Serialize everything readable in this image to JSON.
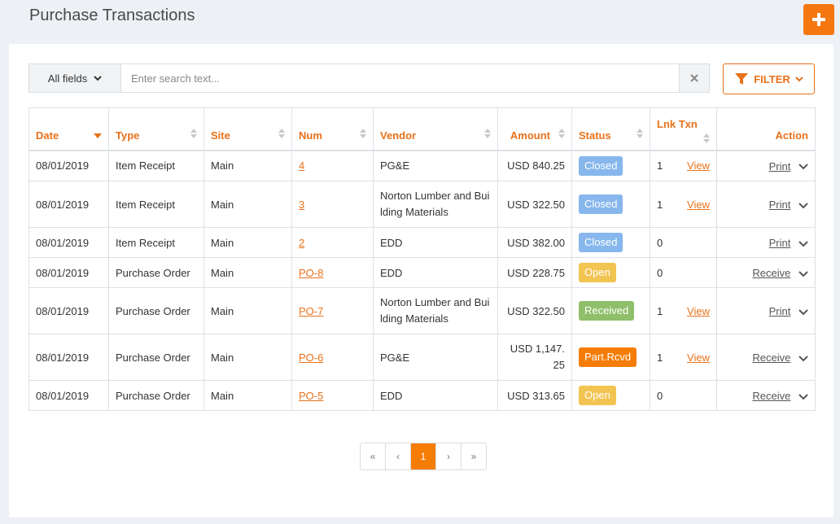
{
  "header": {
    "title": "Purchase Transactions"
  },
  "search": {
    "field": "All fields",
    "placeholder": "Enter search text..."
  },
  "filter": {
    "label": "FILTER"
  },
  "columns": {
    "date": "Date",
    "type": "Type",
    "site": "Site",
    "num": "Num",
    "vendor": "Vendor",
    "amount": "Amount",
    "status": "Status",
    "lnk": "Lnk Txn",
    "action": "Action"
  },
  "rows": [
    {
      "date": "08/01/2019",
      "type": "Item Receipt",
      "site": "Main",
      "num": "4",
      "vendor": "PG&E",
      "amount": "USD 840.25",
      "status": "Closed",
      "lnk": "1",
      "view": "View",
      "action": "Print"
    },
    {
      "date": "08/01/2019",
      "type": "Item Receipt",
      "site": "Main",
      "num": "3",
      "vendor": "Norton Lumber and Building Materials",
      "amount": "USD 322.50",
      "status": "Closed",
      "lnk": "1",
      "view": "View",
      "action": "Print"
    },
    {
      "date": "08/01/2019",
      "type": "Item Receipt",
      "site": "Main",
      "num": "2",
      "vendor": "EDD",
      "amount": "USD 382.00",
      "status": "Closed",
      "lnk": "0",
      "view": "",
      "action": "Print"
    },
    {
      "date": "08/01/2019",
      "type": "Purchase Order",
      "site": "Main",
      "num": "PO-8",
      "vendor": "EDD",
      "amount": "USD 228.75",
      "status": "Open",
      "lnk": "0",
      "view": "",
      "action": "Receive"
    },
    {
      "date": "08/01/2019",
      "type": "Purchase Order",
      "site": "Main",
      "num": "PO-7",
      "vendor": "Norton Lumber and Building Materials",
      "amount": "USD 322.50",
      "status": "Received",
      "lnk": "1",
      "view": "View",
      "action": "Print"
    },
    {
      "date": "08/01/2019",
      "type": "Purchase Order",
      "site": "Main",
      "num": "PO-6",
      "vendor": "PG&E",
      "amount": "USD 1,147.25",
      "status": "Part.Rcvd",
      "lnk": "1",
      "view": "View",
      "action": "Receive"
    },
    {
      "date": "08/01/2019",
      "type": "Purchase Order",
      "site": "Main",
      "num": "PO-5",
      "vendor": "EDD",
      "amount": "USD 313.65",
      "status": "Open",
      "lnk": "0",
      "view": "",
      "action": "Receive"
    }
  ],
  "pagination": {
    "first": "«",
    "prev": "‹",
    "current": "1",
    "next": "›",
    "last": "»"
  },
  "icons": {
    "add": "plus-icon",
    "clear": "close-icon",
    "filter": "filter-icon",
    "sort": "sort-icon",
    "dropdown": "chevron-down-icon"
  },
  "colors": {
    "accent": "#e8711a",
    "closed": "#87b7ec",
    "open": "#f2c452",
    "received": "#8fbf6a",
    "part_rcvd": "#f57c05"
  }
}
